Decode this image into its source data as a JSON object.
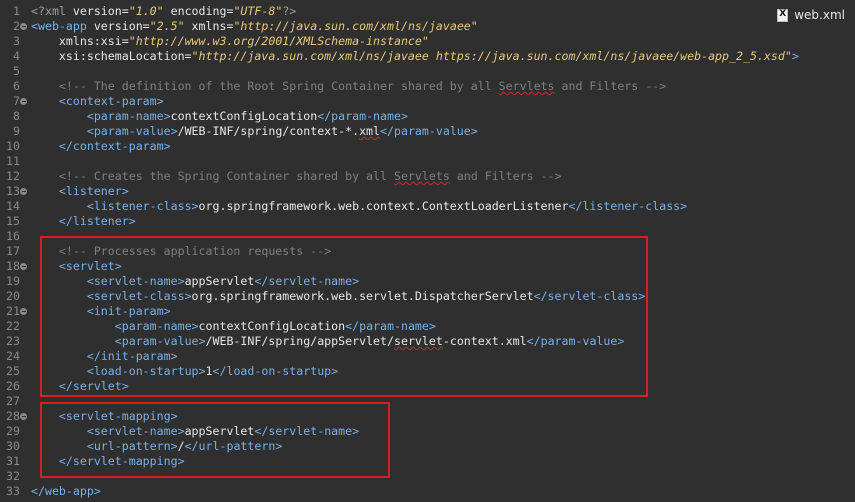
{
  "tab": {
    "icon": "xml-file-icon",
    "label": "web.xml"
  },
  "editor": {
    "lines": [
      {
        "n": "1",
        "fold": false,
        "indent": 0,
        "segments": [
          {
            "t": "pi",
            "v": "<?xml"
          },
          {
            "t": "attr",
            "v": " version="
          },
          {
            "t": "val",
            "v": "\"1.0\""
          },
          {
            "t": "attr",
            "v": " encoding="
          },
          {
            "t": "val",
            "v": "\"UTF-8\""
          },
          {
            "t": "pi",
            "v": "?>"
          }
        ]
      },
      {
        "n": "2",
        "fold": true,
        "indent": 0,
        "segments": [
          {
            "t": "tag",
            "v": "<web-app"
          },
          {
            "t": "attr",
            "v": " version="
          },
          {
            "t": "val",
            "v": "\"2.5\""
          },
          {
            "t": "attr",
            "v": " xmlns="
          },
          {
            "t": "val",
            "v": "\"http://java.sun.com/xml/ns/javaee\""
          }
        ]
      },
      {
        "n": "3",
        "fold": false,
        "indent": 1,
        "segments": [
          {
            "t": "attr",
            "v": "xmlns:xsi="
          },
          {
            "t": "val",
            "v": "\"http://www.w3.org/2001/XMLSchema-instance\""
          }
        ]
      },
      {
        "n": "4",
        "fold": false,
        "indent": 1,
        "segments": [
          {
            "t": "attr",
            "v": "xsi:schemaLocation="
          },
          {
            "t": "val",
            "v": "\"http://java.sun.com/xml/ns/javaee https://java.sun.com/xml/ns/javaee/web-app_2_5.xsd\""
          },
          {
            "t": "tag",
            "v": ">"
          }
        ]
      },
      {
        "n": "5",
        "fold": false,
        "indent": 0,
        "segments": []
      },
      {
        "n": "6",
        "fold": false,
        "indent": 1,
        "segments": [
          {
            "t": "com",
            "v": "<!-- The definition of the Root Spring Container shared by all "
          },
          {
            "t": "comsq",
            "v": "Servlets"
          },
          {
            "t": "com",
            "v": " and Filters -->"
          }
        ]
      },
      {
        "n": "7",
        "fold": true,
        "indent": 1,
        "segments": [
          {
            "t": "tag",
            "v": "<context-param>"
          }
        ]
      },
      {
        "n": "8",
        "fold": false,
        "indent": 2,
        "segments": [
          {
            "t": "tag",
            "v": "<param-name>"
          },
          {
            "t": "txt",
            "v": "contextConfigLocation"
          },
          {
            "t": "tag",
            "v": "</param-name>"
          }
        ]
      },
      {
        "n": "9",
        "fold": false,
        "indent": 2,
        "segments": [
          {
            "t": "tag",
            "v": "<param-value>"
          },
          {
            "t": "txt",
            "v": "/WEB-INF/spring/context-*."
          },
          {
            "t": "txtsq",
            "v": "xml"
          },
          {
            "t": "tag",
            "v": "</param-value>"
          }
        ]
      },
      {
        "n": "10",
        "fold": false,
        "indent": 1,
        "segments": [
          {
            "t": "tag",
            "v": "</context-param>"
          }
        ]
      },
      {
        "n": "11",
        "fold": false,
        "indent": 0,
        "segments": []
      },
      {
        "n": "12",
        "fold": false,
        "indent": 1,
        "segments": [
          {
            "t": "com",
            "v": "<!-- Creates the Spring Container shared by all "
          },
          {
            "t": "comsq",
            "v": "Servlets"
          },
          {
            "t": "com",
            "v": " and Filters -->"
          }
        ]
      },
      {
        "n": "13",
        "fold": true,
        "indent": 1,
        "segments": [
          {
            "t": "tag",
            "v": "<listener>"
          }
        ]
      },
      {
        "n": "14",
        "fold": false,
        "indent": 2,
        "segments": [
          {
            "t": "tag",
            "v": "<listener-class>"
          },
          {
            "t": "txt",
            "v": "org.springframework.web.context.ContextLoaderListener"
          },
          {
            "t": "tag",
            "v": "</listener-class>"
          }
        ]
      },
      {
        "n": "15",
        "fold": false,
        "indent": 1,
        "segments": [
          {
            "t": "tag",
            "v": "</listener>"
          }
        ]
      },
      {
        "n": "16",
        "fold": false,
        "indent": 0,
        "segments": []
      },
      {
        "n": "17",
        "fold": false,
        "indent": 1,
        "segments": [
          {
            "t": "com",
            "v": "<!-- Processes application requests -->"
          }
        ]
      },
      {
        "n": "18",
        "fold": true,
        "indent": 1,
        "segments": [
          {
            "t": "tag",
            "v": "<servlet>"
          }
        ]
      },
      {
        "n": "19",
        "fold": false,
        "indent": 2,
        "segments": [
          {
            "t": "tag",
            "v": "<servlet-name>"
          },
          {
            "t": "txt",
            "v": "appServlet"
          },
          {
            "t": "tag",
            "v": "</servlet-name>"
          }
        ]
      },
      {
        "n": "20",
        "fold": false,
        "indent": 2,
        "segments": [
          {
            "t": "tag",
            "v": "<servlet-class>"
          },
          {
            "t": "txt",
            "v": "org.springframework.web.servlet.DispatcherServlet"
          },
          {
            "t": "tag",
            "v": "</servlet-class>"
          }
        ]
      },
      {
        "n": "21",
        "fold": true,
        "indent": 2,
        "segments": [
          {
            "t": "tag",
            "v": "<init-param>"
          }
        ]
      },
      {
        "n": "22",
        "fold": false,
        "indent": 3,
        "segments": [
          {
            "t": "tag",
            "v": "<param-name>"
          },
          {
            "t": "txt",
            "v": "contextConfigLocation"
          },
          {
            "t": "tag",
            "v": "</param-name>"
          }
        ]
      },
      {
        "n": "23",
        "fold": false,
        "indent": 3,
        "segments": [
          {
            "t": "tag",
            "v": "<param-value>"
          },
          {
            "t": "txt",
            "v": "/WEB-INF/spring/appServlet/"
          },
          {
            "t": "txtsq",
            "v": "servlet"
          },
          {
            "t": "txt",
            "v": "-context.xml"
          },
          {
            "t": "tag",
            "v": "</param-value>"
          }
        ]
      },
      {
        "n": "24",
        "fold": false,
        "indent": 2,
        "segments": [
          {
            "t": "tag",
            "v": "</init-param>"
          }
        ]
      },
      {
        "n": "25",
        "fold": false,
        "indent": 2,
        "segments": [
          {
            "t": "tag",
            "v": "<load-on-startup>"
          },
          {
            "t": "txt",
            "v": "1"
          },
          {
            "t": "tag",
            "v": "</load-on-startup>"
          }
        ]
      },
      {
        "n": "26",
        "fold": false,
        "indent": 1,
        "segments": [
          {
            "t": "tag",
            "v": "</servlet>"
          }
        ]
      },
      {
        "n": "27",
        "fold": false,
        "indent": 0,
        "segments": []
      },
      {
        "n": "28",
        "fold": true,
        "indent": 1,
        "segments": [
          {
            "t": "tag",
            "v": "<servlet-mapping>"
          }
        ]
      },
      {
        "n": "29",
        "fold": false,
        "indent": 2,
        "segments": [
          {
            "t": "tag",
            "v": "<servlet-name>"
          },
          {
            "t": "txt",
            "v": "appServlet"
          },
          {
            "t": "tag",
            "v": "</servlet-name>"
          }
        ]
      },
      {
        "n": "30",
        "fold": false,
        "indent": 2,
        "segments": [
          {
            "t": "tag",
            "v": "<url-pattern>"
          },
          {
            "t": "txt",
            "v": "/"
          },
          {
            "t": "tag",
            "v": "</url-pattern>"
          }
        ]
      },
      {
        "n": "31",
        "fold": false,
        "indent": 1,
        "segments": [
          {
            "t": "tag",
            "v": "</servlet-mapping>"
          }
        ]
      },
      {
        "n": "32",
        "fold": false,
        "indent": 0,
        "segments": []
      },
      {
        "n": "33",
        "fold": false,
        "indent": 0,
        "segments": [
          {
            "t": "tag",
            "v": "</web-app>"
          }
        ]
      }
    ]
  },
  "colors": {
    "background": "#2f2f2f",
    "tag": "#79b0e8",
    "attribute_value": "#e8c97a",
    "comment": "#7f7f7f",
    "text": "#e8e8e8",
    "highlight_border": "#d81e1e"
  }
}
